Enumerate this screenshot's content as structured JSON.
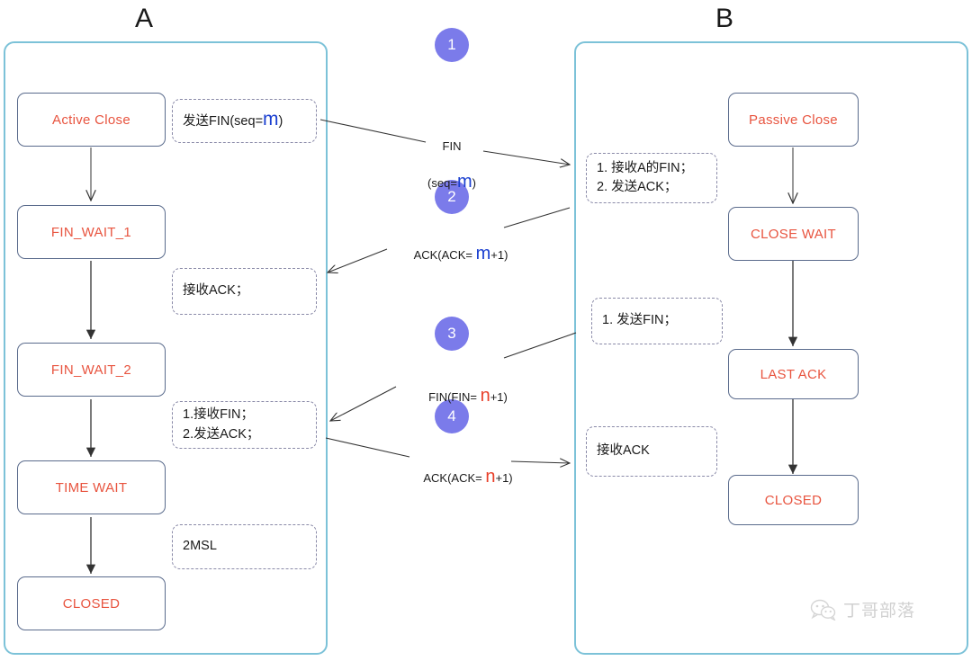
{
  "panels": {
    "left": {
      "title": "A"
    },
    "right": {
      "title": "B"
    }
  },
  "colors": {
    "panel_border": "#7cc2d8",
    "state_border": "#5a6b8c",
    "state_text": "#e8543f",
    "note_border": "#8a8aa8",
    "step_circle": "#7b7bea",
    "highlight_blue": "#1a3fd0",
    "highlight_red": "#e8402a",
    "arrow": "#333333"
  },
  "left_states": [
    {
      "label": "Active Close"
    },
    {
      "label": "FIN_WAIT_1"
    },
    {
      "label": "FIN_WAIT_2"
    },
    {
      "label": "TIME WAIT"
    },
    {
      "label": "CLOSED"
    }
  ],
  "right_states": [
    {
      "label": "Passive Close"
    },
    {
      "label": "CLOSE WAIT"
    },
    {
      "label": "LAST ACK"
    },
    {
      "label": "CLOSED"
    }
  ],
  "left_notes": [
    {
      "text_pre": "发送FIN(seq=",
      "highlight": "m",
      "text_post": ")"
    },
    {
      "text_pre": "接收ACK；",
      "highlight": "",
      "text_post": ""
    },
    {
      "text_pre": "1.接收FIN；\n2.发送ACK；",
      "highlight": "",
      "text_post": ""
    },
    {
      "text_pre": "2MSL",
      "highlight": "",
      "text_post": ""
    }
  ],
  "right_notes": [
    {
      "text_pre": "1. 接收A的FIN；\n2. 发送ACK；",
      "highlight": "",
      "text_post": ""
    },
    {
      "text_pre": "1. 发送FIN；",
      "highlight": "",
      "text_post": ""
    },
    {
      "text_pre": "接收ACK",
      "highlight": "",
      "text_post": ""
    }
  ],
  "steps": [
    {
      "number": "1"
    },
    {
      "number": "2"
    },
    {
      "number": "3"
    },
    {
      "number": "4"
    }
  ],
  "messages": [
    {
      "line1": "FIN",
      "pre": "(seq=",
      "highlight": "m",
      "post": ")",
      "color": "blue",
      "direction": "a-to-b"
    },
    {
      "line1": "",
      "pre": "ACK(ACK= ",
      "highlight": "m",
      "post": "+1)",
      "color": "blue",
      "direction": "b-to-a"
    },
    {
      "line1": "",
      "pre": "FIN(FIN= ",
      "highlight": "n",
      "post": "+1)",
      "color": "red",
      "direction": "b-to-a"
    },
    {
      "line1": "",
      "pre": "ACK(ACK= ",
      "highlight": "n",
      "post": "+1)",
      "color": "red",
      "direction": "a-to-b"
    }
  ],
  "watermark": {
    "icon": "wechat-icon",
    "text": "丁哥部落"
  }
}
